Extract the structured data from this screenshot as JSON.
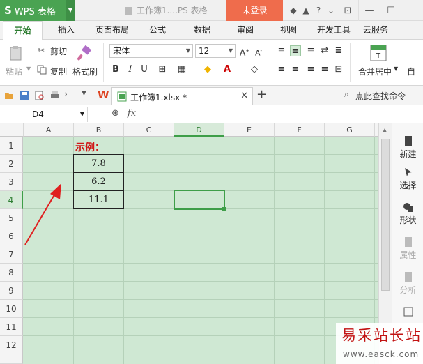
{
  "titlebar": {
    "app_name": "WPS 表格",
    "doc_title": "工作簿1....PS 表格",
    "login": "未登录"
  },
  "menu": {
    "tabs": [
      "开始",
      "插入",
      "页面布局",
      "公式",
      "数据",
      "审阅",
      "视图",
      "开发工具",
      "云服务"
    ],
    "active": 0
  },
  "ribbon": {
    "paste": "粘贴",
    "cut": "剪切",
    "copy": "复制",
    "format_painter": "格式刷",
    "font_name": "宋体",
    "font_size": "12",
    "merge_center": "合并居中",
    "auto_label": "自"
  },
  "qbar": {
    "file_tab": "工作簿1.xlsx *",
    "find_command": "点此查找命令"
  },
  "formula_bar": {
    "name_box": "D4",
    "fx": "fx"
  },
  "grid": {
    "columns": [
      "A",
      "B",
      "C",
      "D",
      "E",
      "F",
      "G"
    ],
    "rows": [
      "1",
      "2",
      "3",
      "4",
      "5",
      "6",
      "7",
      "8",
      "9",
      "10",
      "11",
      "12"
    ],
    "active_column": "D",
    "active_row": "4"
  },
  "cells": {
    "b1": "示例：",
    "b2": "7.8",
    "b3": "6.2",
    "b4": "11.1"
  },
  "right_panel": {
    "items": [
      "新建",
      "选择",
      "形状",
      "属性",
      "分析"
    ]
  },
  "watermark": {
    "title": "易采站长站",
    "url": "www.easck.com"
  },
  "colors": {
    "accent": "#4aa352",
    "login_bg": "#ef6c4c",
    "grid_bg": "#cfe8d3",
    "annotation_red": "#e02020"
  }
}
